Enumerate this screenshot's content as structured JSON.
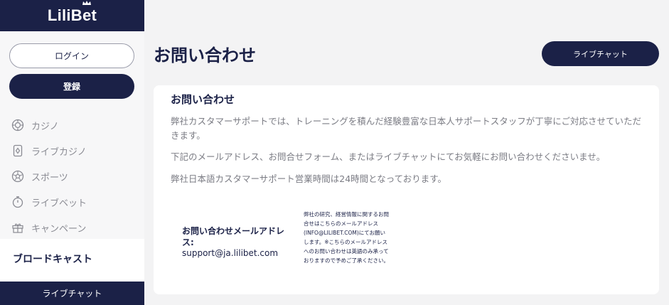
{
  "sidebar": {
    "logo": "LiliBet",
    "login_label": "ログイン",
    "register_label": "登録",
    "nav_items": [
      {
        "label": "カジノ",
        "icon": "chip-icon"
      },
      {
        "label": "ライブカジノ",
        "icon": "card-icon"
      },
      {
        "label": "スポーツ",
        "icon": "soccer-ball-icon"
      },
      {
        "label": "ライブベット",
        "icon": "stopwatch-icon"
      },
      {
        "label": "キャンペーン",
        "icon": "gift-icon"
      }
    ],
    "broadcast_label": "ブロードキャスト",
    "live_chat_label": "ライブチャット"
  },
  "main": {
    "page_title": "お問い合わせ",
    "live_chat_button": "ライブチャット",
    "card": {
      "title": "お問い合わせ",
      "paragraphs": [
        "弊社カスタマーサポートでは、トレーニングを積んだ経験豊富な日本人サポートスタッフが丁寧にご対応させていただきます。",
        "下記のメールアドレス、お問合せフォーム、またはライブチャットにてお気軽にお問い合わせくださいませ。",
        "弊社日本語カスタマーサポート営業時間は24時間となっております。"
      ],
      "email_label": "お問い合わせメールアドレス:",
      "email_value": "support@ja.lilibet.com",
      "note": "弊社の研究、経営情報に関するお問合せはこちらのメールアドレス(INFO@LILIBET.COM)にてお願いします。※こちらのメールアドレスへのお問い合わせは英語のみ承っておりますので予めご了承ください。"
    }
  },
  "colors": {
    "navy": "#1b2147",
    "background": "#f3f3f4",
    "muted_text": "#7b7c84"
  }
}
